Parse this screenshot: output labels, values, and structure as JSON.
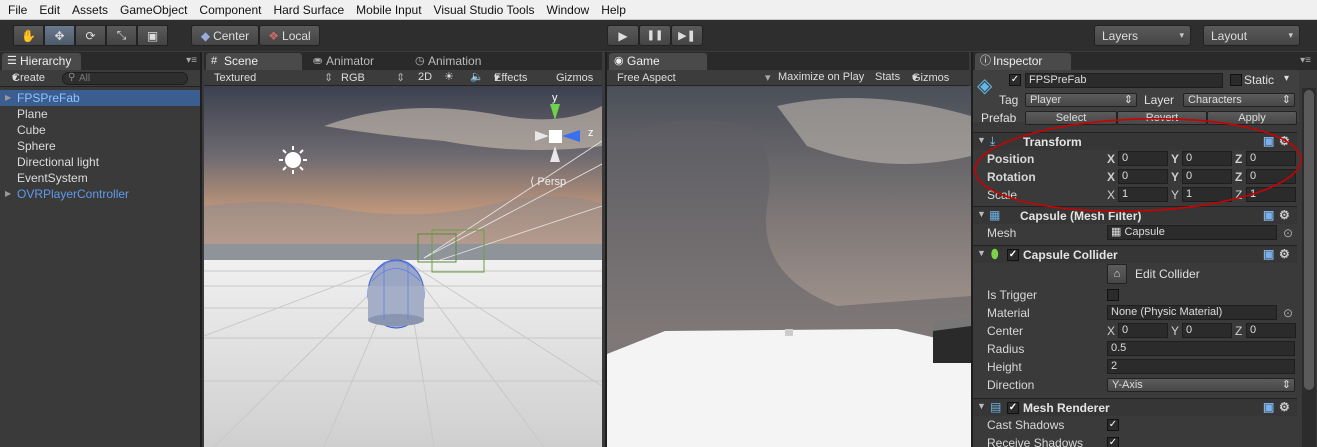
{
  "menu": [
    "File",
    "Edit",
    "Assets",
    "GameObject",
    "Component",
    "Hard Surface",
    "Mobile Input",
    "Visual Studio Tools",
    "Window",
    "Help"
  ],
  "toolbar": {
    "tools": [
      "hand-icon",
      "move-icon",
      "rotate-icon",
      "scale-icon",
      "rect-icon"
    ],
    "pivot_label": "Center",
    "space_label": "Local",
    "play": "▶",
    "pause": "❚❚",
    "step": "▶❚",
    "layers_label": "Layers",
    "layout_label": "Layout"
  },
  "hierarchy": {
    "tab": "Hierarchy",
    "create_label": "Create",
    "search_placeholder": "All",
    "items": [
      {
        "label": "FPSPreFab",
        "state": "selected"
      },
      {
        "label": "Plane",
        "state": "normal"
      },
      {
        "label": "Cube",
        "state": "normal"
      },
      {
        "label": "Sphere",
        "state": "normal"
      },
      {
        "label": "Directional light",
        "state": "normal"
      },
      {
        "label": "EventSystem",
        "state": "normal"
      },
      {
        "label": "OVRPlayerController",
        "state": "prefab"
      }
    ]
  },
  "scene": {
    "tabs": [
      "Scene",
      "Animator",
      "Animation"
    ],
    "shading": "Textured",
    "render_mode": "RGB",
    "mode_2d": "2D",
    "effects": "Effects",
    "gizmos": "Gizmos",
    "persp_label": "Persp",
    "axis_y": "y",
    "axis_z": "z"
  },
  "game": {
    "tab": "Game",
    "aspect": "Free Aspect",
    "maximize": "Maximize on Play",
    "stats": "Stats",
    "gizmos": "Gizmos"
  },
  "inspector": {
    "tab": "Inspector",
    "object_name": "FPSPreFab",
    "static_label": "Static",
    "tag_label": "Tag",
    "tag_value": "Player",
    "layer_label": "Layer",
    "layer_value": "Characters",
    "prefab_label": "Prefab",
    "prefab_select": "Select",
    "prefab_revert": "Revert",
    "prefab_apply": "Apply",
    "transform": {
      "title": "Transform",
      "position_label": "Position",
      "rotation_label": "Rotation",
      "scale_label": "Scale",
      "position": [
        "0",
        "0",
        "0"
      ],
      "rotation": [
        "0",
        "0",
        "0"
      ],
      "scale": [
        "1",
        "1",
        "1"
      ]
    },
    "mesh_filter": {
      "title": "Capsule (Mesh Filter)",
      "mesh_label": "Mesh",
      "mesh_value": "Capsule"
    },
    "capsule_collider": {
      "title": "Capsule Collider",
      "edit_collider": "Edit Collider",
      "is_trigger_label": "Is Trigger",
      "material_label": "Material",
      "material_value": "None (Physic Material)",
      "center_label": "Center",
      "center": [
        "0",
        "0",
        "0"
      ],
      "radius_label": "Radius",
      "radius": "0.5",
      "height_label": "Height",
      "height": "2",
      "direction_label": "Direction",
      "direction": "Y-Axis"
    },
    "mesh_renderer": {
      "title": "Mesh Renderer",
      "cast_shadows_label": "Cast Shadows",
      "receive_shadows_label": "Receive Shadows"
    },
    "axes": [
      "X",
      "Y",
      "Z"
    ]
  },
  "colors": {
    "selection": "#3b5d8f",
    "annotation": "#cc0000",
    "prefab_text": "#5e9bea"
  }
}
